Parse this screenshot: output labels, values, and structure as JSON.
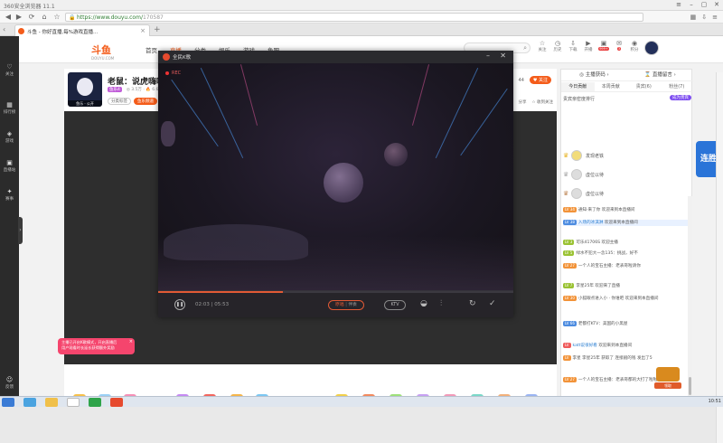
{
  "browser": {
    "app_title": "360安全浏览器 11.1",
    "url_host": "https://www.douyu.com/",
    "url_path": "170587",
    "tab_title": "斗鱼 - 你好直播,每%游戏直播...",
    "nav": [
      "◀",
      "▶",
      "⟳",
      "⌂",
      "☆"
    ]
  },
  "site": {
    "logo": "斗鱼",
    "logo_sub": "DOUYU.COM",
    "nav": [
      "首页",
      "直播",
      "分类",
      "娱乐",
      "游戏",
      "鱼吧"
    ],
    "active_nav": "直播",
    "top_icons": [
      {
        "label": "关注",
        "glyph": "☆"
      },
      {
        "label": "历史",
        "glyph": "◷"
      },
      {
        "label": "下载",
        "glyph": "⇩"
      },
      {
        "label": "开播",
        "glyph": "▶"
      },
      {
        "label": "客户端",
        "glyph": "▣",
        "badge": "999+"
      },
      {
        "label": "消息",
        "glyph": "✉",
        "badge": "3"
      },
      {
        "label": "积分",
        "glyph": "◉"
      }
    ],
    "left_nav": [
      {
        "label": "关注",
        "glyph": "♡"
      },
      {
        "label": "排行榜",
        "glyph": "▦"
      },
      {
        "label": "游戏",
        "glyph": "◈"
      },
      {
        "label": "直播站",
        "glyph": "▣"
      },
      {
        "label": "赛事",
        "glyph": "✦"
      },
      {
        "label": "反馈",
        "glyph": "☺"
      }
    ]
  },
  "room": {
    "avatar_tag": "鱼乐 · 公开",
    "title": "老鼠：说虎嗨嗨",
    "tag_level": "鱼乐4",
    "tag_meta": "◎ 3.5万 · 🔥 6.6",
    "tag_bottom": [
      "分类标签",
      "鱼乐频道"
    ],
    "follow": "♥ 关注",
    "follow_count": "44",
    "right_links": [
      "举",
      "分享",
      "☆ 收到关注"
    ]
  },
  "ktv": {
    "title": "全民K歌",
    "rec": "REC",
    "time_current": "02:03",
    "time_total": "05:53",
    "progress": 0.35,
    "mode_on": "原唱",
    "mode_off": "伴奏",
    "ktv_label": "KTV"
  },
  "toast": {
    "line1": "主播已开启K歌模式，开启直播后",
    "line2": "用户观看时长延长获得额外奖励"
  },
  "chat": {
    "top": [
      "◎ 主播获码 ›",
      "⌛ 直播留言 ›"
    ],
    "tabs": [
      "今日贡献",
      "本周贡献",
      "贵宾(6)",
      "粉丝(7)"
    ],
    "active_tab": "今日贡献",
    "rank_title": "贵宾亲密度排行",
    "rank_btn": "成为贵宾",
    "ranks": [
      "发现老铁",
      "虚位以待",
      "虚位以待"
    ],
    "messages": [
      {
        "lv": "LV 34",
        "lvclass": "lv-o",
        "user": "",
        "text": "通知·来了你 欢迎来到本直播间"
      },
      {
        "lv": "LV 38",
        "lvclass": "lv-b",
        "user": "入场的冰淇淋",
        "text": " 欢迎来到本直播间",
        "hl": true
      },
      {
        "lv": "LV 3",
        "lvclass": "lv-g",
        "user": "",
        "text": "可乐41706S 欢迎主播"
      },
      {
        "lv": "LV 5",
        "lvclass": "lv-g",
        "user": "",
        "text": "绿水不犯大一念135：挑战，好不"
      },
      {
        "lv": "LV 27",
        "lvclass": "lv-o",
        "user": "",
        "text": "一个人的宝石主播：老表哥啦请你"
      },
      {
        "lv": "LV 7",
        "lvclass": "lv-g",
        "user": "",
        "text": "李星25年 欢迎来了直播"
      },
      {
        "lv": "LV 30",
        "lvclass": "lv-o",
        "user": "",
        "text": "小狐眼点进入小 · 你谁吧 欢迎来到本直播间"
      },
      {
        "lv": "LV 66",
        "lvclass": "lv-b",
        "user": "",
        "text": "老都打KTV：美国的小黑屋"
      },
      {
        "lv": "LV",
        "lvclass": "lv-r",
        "user": "katt说很好看",
        "text": " 欢迎来到本直播间"
      },
      {
        "lv": "LV",
        "lvclass": "lv-o",
        "user": "",
        "text": "李星 李星25年 获取了 连接剧的钱 发出了5"
      },
      {
        "lv": "LV 27",
        "lvclass": "lv-o",
        "user": "",
        "text": "一个人的宝石主播：老表哥都的大打了啦啦啦"
      },
      {
        "lv": "LV 23",
        "lvclass": "lv-b",
        "user": "下面大宝的暴蹦",
        "text": " 欢迎来到本直播间"
      },
      {
        "lv": "LV 16",
        "lvclass": "lv-g",
        "user": "sotele",
        "text": " 欢迎来到本直播间"
      }
    ],
    "lock_label": "☐ 屏幕锁定",
    "side_badge": "连胜",
    "chest_label": "领取"
  },
  "taskbar": {
    "time": "10:51"
  },
  "colors": {
    "brand": "#f45c1a",
    "accent": "#7d4df0",
    "rec": "#e25a35"
  }
}
